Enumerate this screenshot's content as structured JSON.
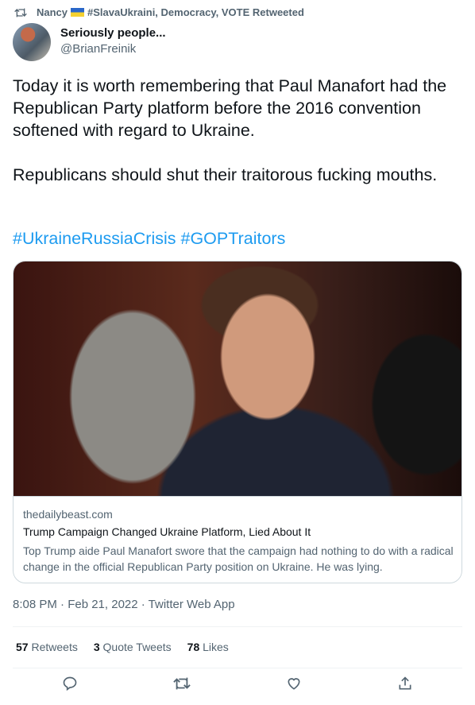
{
  "retweet_context": {
    "user": "Nancy",
    "rest": "#SlavaUkraini, Democracy, VOTE Retweeted"
  },
  "author": {
    "name": "Seriously people...",
    "handle": "@BrianFreinik"
  },
  "tweet": {
    "text": "Today it is worth remembering that Paul Manafort had the Republican Party platform before the 2016 convention softened with regard to Ukraine.\n\nRepublicans should shut their traitorous fucking mouths.",
    "hashtags": [
      "#UkraineRussiaCrisis",
      "#GOPTraitors"
    ]
  },
  "card": {
    "domain": "thedailybeast.com",
    "title": "Trump Campaign Changed Ukraine Platform, Lied About It",
    "description": "Top Trump aide Paul Manafort swore that the campaign had nothing to do with a radical change in the official Republican Party position on Ukraine. He was lying."
  },
  "meta": "8:08 PM · Feb 21, 2022 · Twitter Web App",
  "stats": {
    "retweets": "57",
    "retweets_label": "Retweets",
    "quotes": "3",
    "quotes_label": "Quote Tweets",
    "likes": "78",
    "likes_label": "Likes"
  },
  "colors": {
    "link": "#1d9bf0",
    "secondary": "#536471"
  }
}
